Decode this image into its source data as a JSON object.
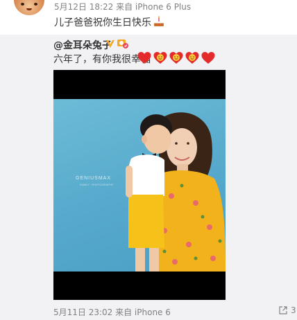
{
  "post": {
    "meta": "5月12日 18:22 来自 iPhone 6 Plus",
    "text": "儿子爸爸祝你生日快乐"
  },
  "repost": {
    "author": "@金耳朵兔子",
    "text": "六年了，有你我很幸福",
    "photo_caption": "GENIUSMAX",
    "photo_caption_sub": "FAMILY · PHOTOGRAPHY",
    "meta": "5月11日 23:02 来自 iPhone 6",
    "share_count": "3"
  },
  "colors": {
    "meta_text": "#808080",
    "body_text": "#333333",
    "repost_bg": "#f2f2f5",
    "heart_red": "#e32b2b",
    "verified_gold": "#f5a623",
    "photo_sky": "#56a9cc",
    "dress_yellow": "#f2b21b"
  },
  "icons": {
    "cake": "cake-emoji",
    "verified": "verified-v-badge",
    "flag": "member-flag-badge",
    "heart": "heart-emoji",
    "share": "share-icon"
  }
}
